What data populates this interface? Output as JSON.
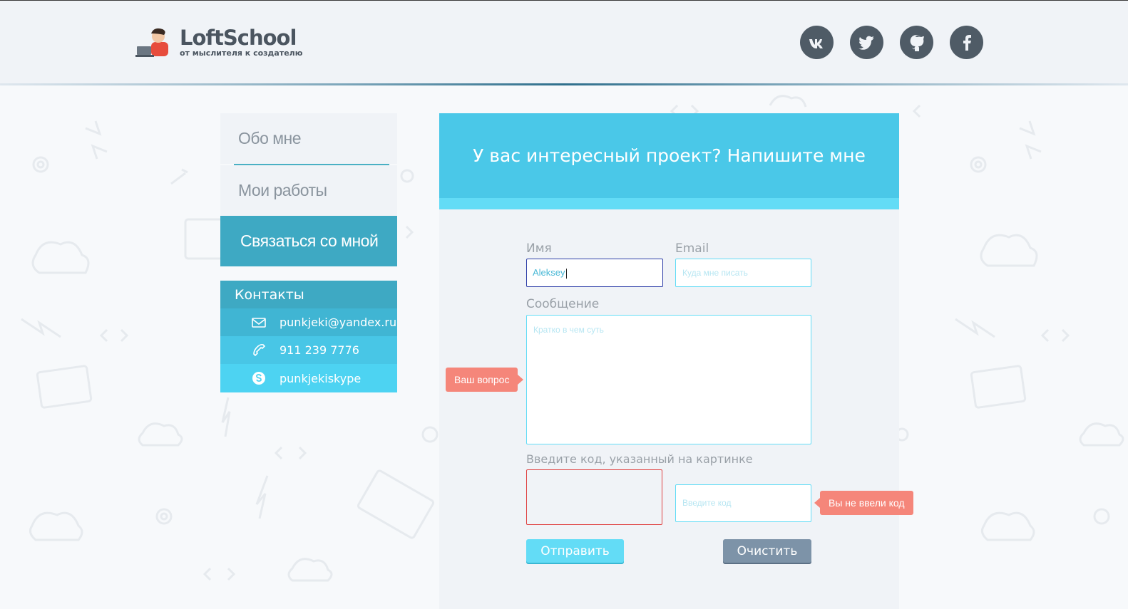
{
  "header": {
    "logo_name": "LoftSchool",
    "logo_tagline": "от мыслителя к создателю",
    "socials": [
      {
        "icon": "vk-icon"
      },
      {
        "icon": "twitter-icon"
      },
      {
        "icon": "github-icon"
      },
      {
        "icon": "facebook-icon"
      }
    ]
  },
  "menu": {
    "items": [
      {
        "label": "Обо мне"
      },
      {
        "label": "Мои работы"
      },
      {
        "label": "Связаться со мной",
        "active": true
      }
    ]
  },
  "contacts": {
    "title": "Контакты",
    "email": "punkjeki@yandex.ru",
    "phone": "911 239 7776",
    "skype": "punkjekiskype"
  },
  "form": {
    "title": "У вас интересный проект? Напишите мне",
    "name_label": "Имя",
    "name_value": "Aleksey",
    "email_label": "Email",
    "email_placeholder": "Куда мне писать",
    "message_label": "Сообщение",
    "message_placeholder": "Кратко в чем суть",
    "captcha_label": "Введите код, указанный на картинке",
    "code_placeholder": "Введите код",
    "send_label": "Отправить",
    "clear_label": "Очистить",
    "tooltip_question": "Ваш вопрос",
    "tooltip_code_error": "Вы не ввели код"
  },
  "colors": {
    "accent": "#4ac8e8",
    "menu_active": "#3ea9c3",
    "error": "#e04343",
    "tooltip": "#f5867a"
  }
}
